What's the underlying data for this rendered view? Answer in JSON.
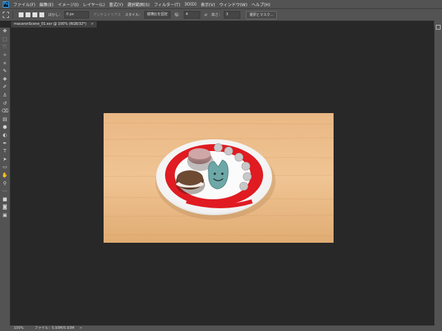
{
  "app": {
    "logo_text": "Ps"
  },
  "menu": [
    "ファイル(F)",
    "編集(E)",
    "イメージ(I)",
    "レイヤー(L)",
    "書式(Y)",
    "選択範囲(S)",
    "フィルター(T)",
    "3D(D)",
    "表示(V)",
    "ウィンドウ(W)",
    "ヘルプ(H)"
  ],
  "options": {
    "feather_label": "ぼかし：",
    "feather_value": "0 px",
    "antialias_label": "アンチエイリアス",
    "style_label": "スタイル：",
    "style_value": "縦横比を固定",
    "width_label": "幅：",
    "width_value": "4",
    "height_label": "高さ：",
    "height_value": "3",
    "mask_button": "選択とマスク..."
  },
  "document": {
    "tab_title": "macaronScene_01.exr @ 100% (RGB/32*)",
    "close_glyph": "×"
  },
  "status": {
    "zoom": "100%",
    "file_info": "ファイル：5.93M/5.93M",
    "arrow": ">"
  },
  "tools": [
    {
      "name": "move-tool",
      "glyph": "✥"
    },
    {
      "name": "marquee-tool",
      "glyph": "⬚"
    },
    {
      "name": "lasso-tool",
      "glyph": "➰"
    },
    {
      "name": "magic-wand-tool",
      "glyph": "✧"
    },
    {
      "name": "crop-tool",
      "glyph": "⌗"
    },
    {
      "name": "eyedropper-tool",
      "glyph": "✎"
    },
    {
      "name": "healing-brush-tool",
      "glyph": "✚"
    },
    {
      "name": "brush-tool",
      "glyph": "✐"
    },
    {
      "name": "clone-stamp-tool",
      "glyph": "♙"
    },
    {
      "name": "history-brush-tool",
      "glyph": "↺"
    },
    {
      "name": "eraser-tool",
      "glyph": "⌫"
    },
    {
      "name": "gradient-tool",
      "glyph": "▤"
    },
    {
      "name": "blur-tool",
      "glyph": "●"
    },
    {
      "name": "dodge-tool",
      "glyph": "◐"
    },
    {
      "name": "pen-tool",
      "glyph": "✒"
    },
    {
      "name": "type-tool",
      "glyph": "T"
    },
    {
      "name": "path-selection-tool",
      "glyph": "➤"
    },
    {
      "name": "rectangle-tool",
      "glyph": "▭"
    },
    {
      "name": "hand-tool",
      "glyph": "✋"
    },
    {
      "name": "zoom-tool",
      "glyph": "⚲"
    },
    {
      "name": "more-tools",
      "glyph": "⋯"
    },
    {
      "name": "color-swatches",
      "glyph": "■"
    },
    {
      "name": "quick-mask-tool",
      "glyph": "◙"
    },
    {
      "name": "screen-mode-tool",
      "glyph": "▣"
    }
  ],
  "colors": {
    "ui_bg": "#535353",
    "workspace_bg": "#282828",
    "tab_bg": "#404040",
    "accent": "#31a8ff"
  }
}
